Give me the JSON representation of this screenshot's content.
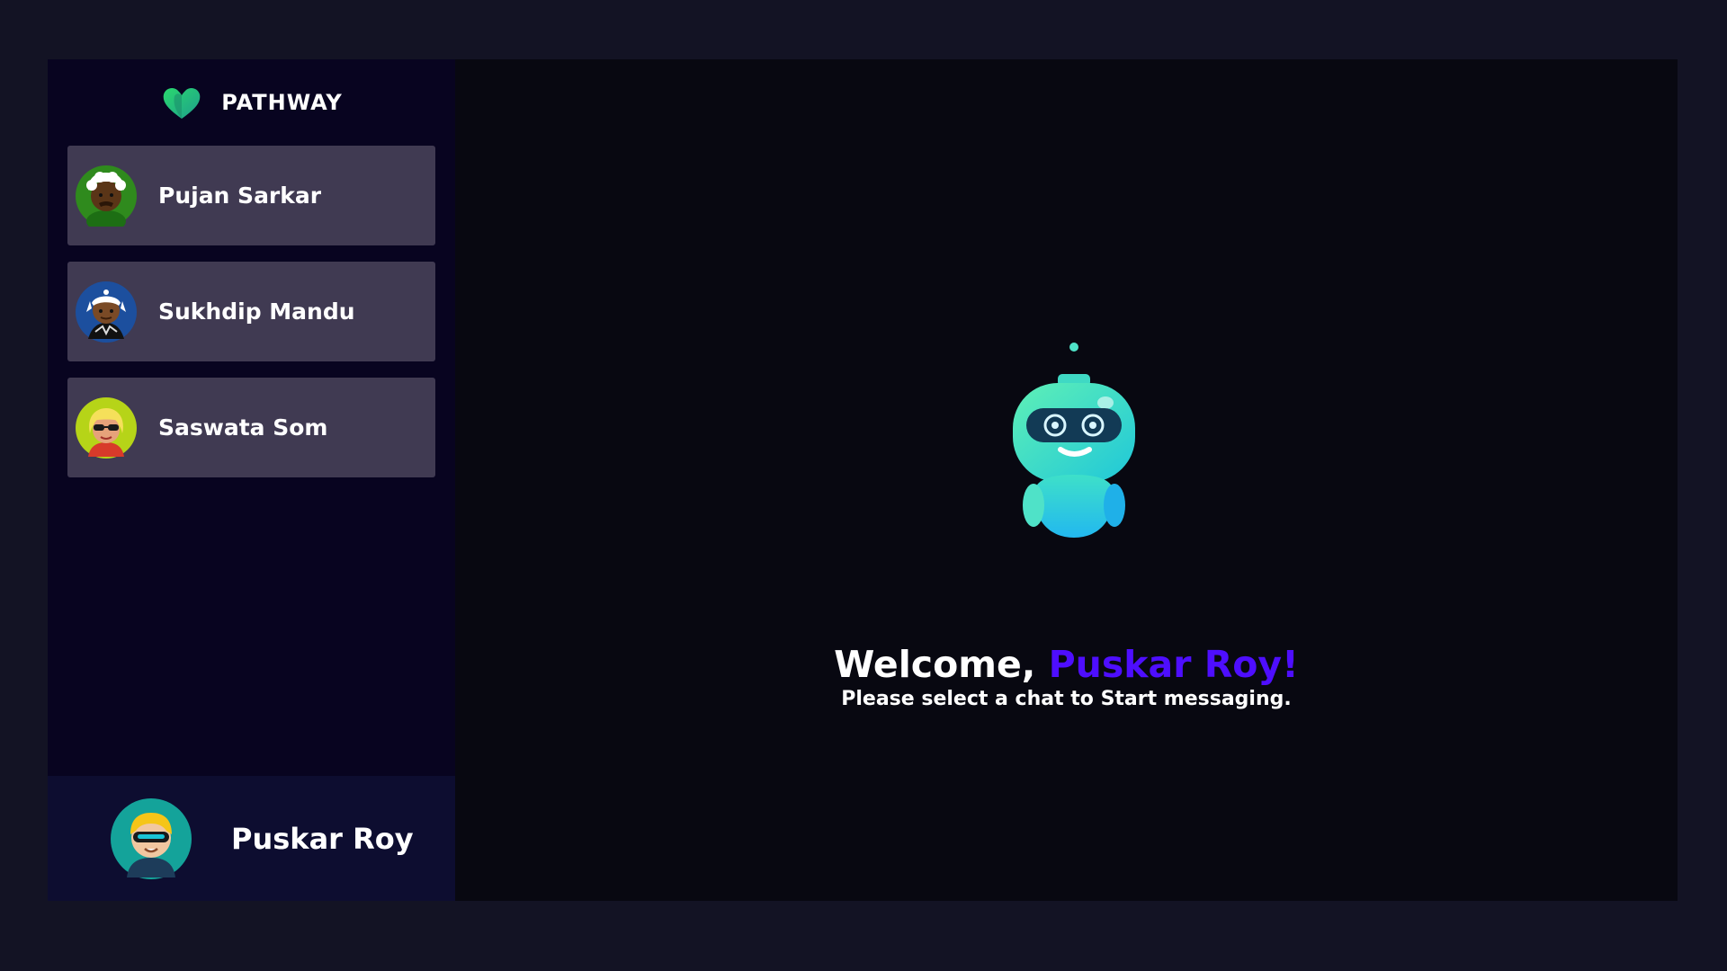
{
  "brand": {
    "name": "PATHWAY",
    "logo_icon": "heart-logo-icon"
  },
  "contacts": [
    {
      "name": "Pujan Sarkar",
      "avatar_icon": "white-hair-avatar-icon"
    },
    {
      "name": "Sukhdip Mandu",
      "avatar_icon": "blue-headband-avatar-icon"
    },
    {
      "name": "Saswata Som",
      "avatar_icon": "sunglasses-avatar-icon"
    }
  ],
  "current_user": {
    "name": "Puskar Roy",
    "avatar_icon": "visor-avatar-icon"
  },
  "welcome": {
    "greeting": "Welcome, ",
    "user_name": "Puskar Roy!",
    "subtitle": "Please select a chat to Start messaging.",
    "robot_icon": "robot-icon"
  },
  "colors": {
    "page_background": "#131324",
    "sidebar_background": "#080420",
    "contact_background": "#403a52",
    "current_user_background": "#0d0d30",
    "main_background": "#080811",
    "accent": "#4e0eff"
  }
}
